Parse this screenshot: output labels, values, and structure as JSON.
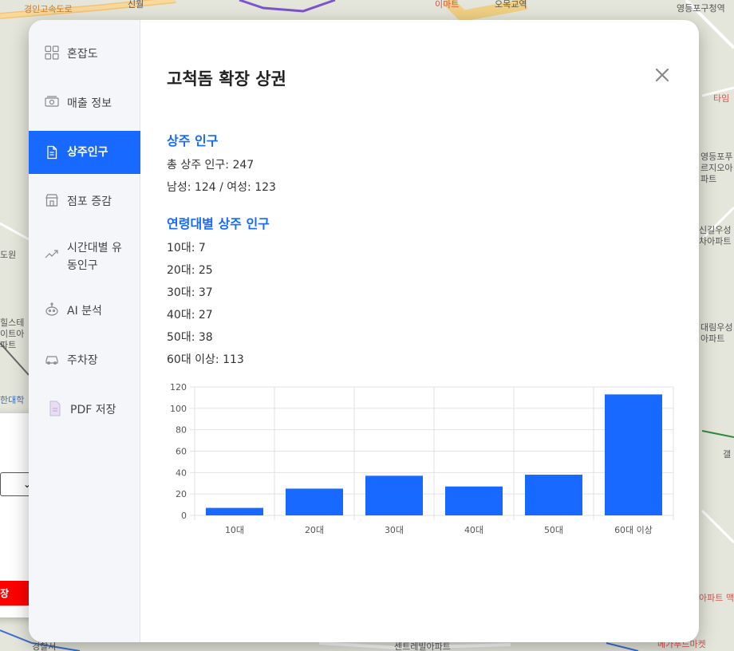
{
  "map": {
    "labels": [
      {
        "text": "경인고속도로",
        "style": ""
      },
      {
        "text": "신월",
        "style": ""
      },
      {
        "text": "이마트",
        "style": "red"
      },
      {
        "text": "오목교역",
        "style": ""
      },
      {
        "text": "영등포구청역",
        "style": ""
      },
      {
        "text": "타임",
        "style": "red"
      },
      {
        "text": "영등포푸르지오아파트",
        "style": ""
      },
      {
        "text": "신길우성차아파트",
        "style": ""
      },
      {
        "text": "대림우성아파트",
        "style": ""
      },
      {
        "text": "도원",
        "style": ""
      },
      {
        "text": "힐스테이트아파트",
        "style": ""
      },
      {
        "text": "한대학",
        "style": ""
      },
      {
        "text": "센트레빌아파트",
        "style": ""
      },
      {
        "text": "경찰서",
        "style": ""
      },
      {
        "text": "아파트 맥스",
        "style": "red"
      },
      {
        "text": "메가푸드마켓",
        "style": "red"
      },
      {
        "text": "갤",
        "style": ""
      }
    ]
  },
  "side_panel": {
    "select_arrow": "⌄",
    "red_button_label": "장"
  },
  "modal": {
    "title": "고척돔 확장 상권",
    "close_icon": "close-icon",
    "nav": [
      {
        "label": "혼잡도",
        "icon": "grid-icon",
        "active": false
      },
      {
        "label": "매출 정보",
        "icon": "money-icon",
        "active": false
      },
      {
        "label": "상주인구",
        "icon": "document-icon",
        "active": true
      },
      {
        "label": "점포 증감",
        "icon": "store-icon",
        "active": false
      },
      {
        "label": "시간대별 유동인구",
        "icon": "trend-icon",
        "active": false
      },
      {
        "label": "AI 분석",
        "icon": "robot-icon",
        "active": false
      },
      {
        "label": "주차장",
        "icon": "car-icon",
        "active": false
      },
      {
        "label": "PDF 저장",
        "icon": "pdf-icon",
        "active": false
      }
    ],
    "resident_title": "상주 인구",
    "resident_total": "총 상주 인구: 247",
    "resident_gender": "남성: 124 / 여성: 123",
    "age_title": "연령대별 상주 인구",
    "age_lines": [
      "10대: 7",
      "20대: 25",
      "30대: 37",
      "40대: 27",
      "50대: 38",
      "60대 이상: 113"
    ],
    "accent_color": "#1769ff"
  },
  "chart_data": {
    "type": "bar",
    "categories": [
      "10대",
      "20대",
      "30대",
      "40대",
      "50대",
      "60대 이상"
    ],
    "values": [
      7,
      25,
      37,
      27,
      38,
      113
    ],
    "ylim": [
      0,
      120
    ],
    "yticks": [
      0,
      20,
      40,
      60,
      80,
      100,
      120
    ],
    "grid": true,
    "bar_color": "#1769ff",
    "title": "",
    "xlabel": "",
    "ylabel": ""
  }
}
